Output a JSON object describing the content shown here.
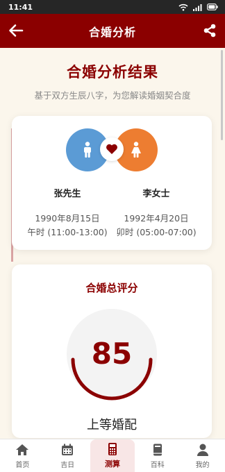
{
  "status_bar": {
    "time": "11:41",
    "icons": [
      "wifi-icon",
      "signal-icon",
      "battery-icon"
    ]
  },
  "header": {
    "title": "合婚分析",
    "back_icon": "arrow-left-icon",
    "share_icon": "share-icon"
  },
  "result": {
    "title": "合婚分析结果",
    "subtitle": "基于双方生辰八字，为您解读婚姻契合度"
  },
  "couple": {
    "male": {
      "name": "张先生",
      "birth_date": "1990年8月15日",
      "birth_hour": "午时 (11:00-13:00)",
      "icon": "male-icon",
      "color": "#5b9bd5"
    },
    "female": {
      "name": "李女士",
      "birth_date": "1992年4月20日",
      "birth_hour": "卯时 (05:00-07:00)",
      "icon": "female-icon",
      "color": "#ed7d31"
    },
    "heart_icon": "heart-icon"
  },
  "score": {
    "title": "合婚总评分",
    "value": "85",
    "fraction": 0.85,
    "level": "上等婚配"
  },
  "tabbar": {
    "items": [
      {
        "label": "首页",
        "icon": "home-icon",
        "active": false
      },
      {
        "label": "吉日",
        "icon": "calendar-icon",
        "active": false
      },
      {
        "label": "测算",
        "icon": "calculator-icon",
        "active": true
      },
      {
        "label": "百科",
        "icon": "book-icon",
        "active": false
      },
      {
        "label": "我的",
        "icon": "user-icon",
        "active": false
      }
    ]
  },
  "colors": {
    "primary": "#8b0000",
    "background": "#fbf6ec",
    "male": "#5b9bd5",
    "female": "#ed7d31"
  }
}
